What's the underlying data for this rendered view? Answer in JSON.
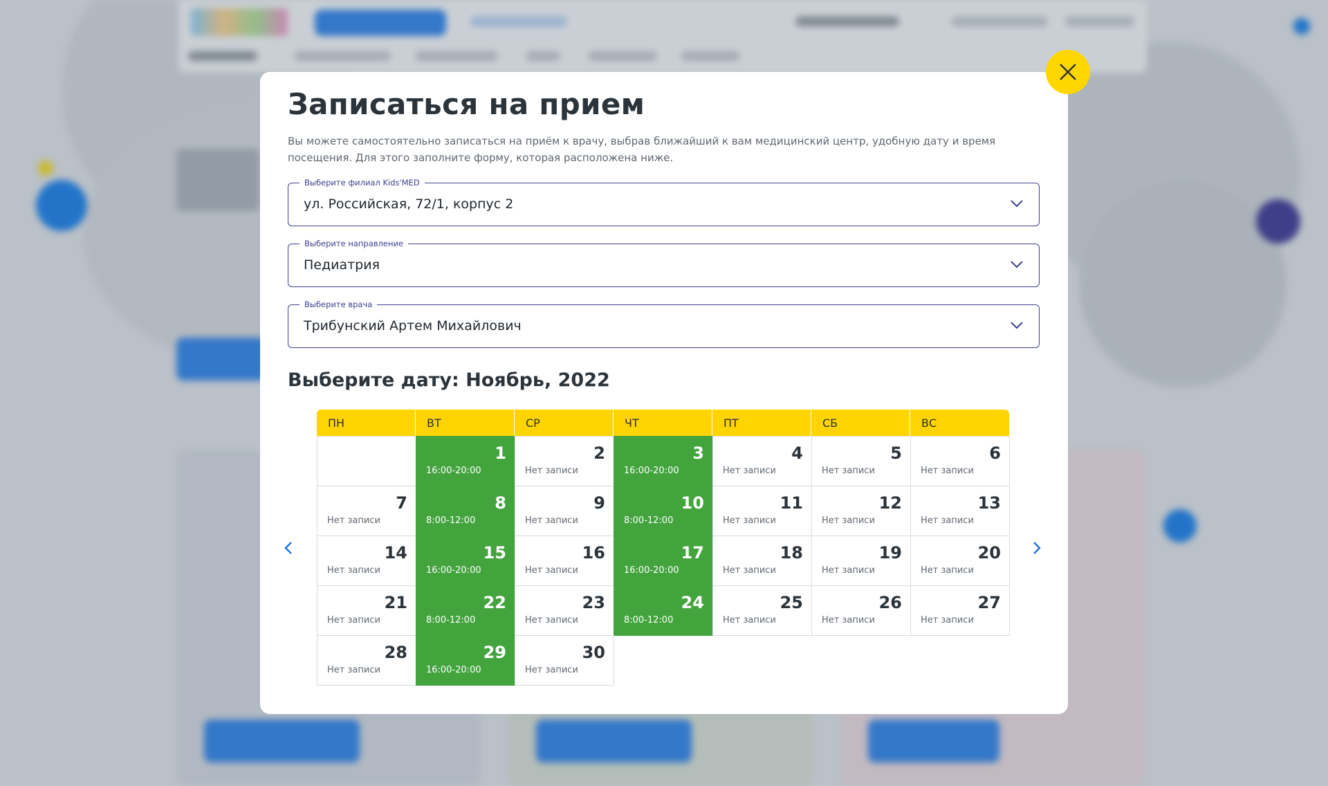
{
  "modal": {
    "title": "Записаться на прием",
    "description": "Вы можете самостоятельно записаться на приём к врачу, выбрав ближайший к вам медицинский центр, удобную дату и время посещения. Для этого заполните форму, которая расположена ниже."
  },
  "fields": {
    "branch": {
      "label": "Выберите филиал Kids'MED",
      "value": "ул. Российская, 72/1, корпус 2"
    },
    "direction": {
      "label": "Выберите направление",
      "value": "Педиатрия"
    },
    "doctor": {
      "label": "Выберите врача",
      "value": "Трибунский Артем Михайлович"
    }
  },
  "calendar": {
    "heading": "Выберите дату: Ноябрь, 2022",
    "weekdays": [
      "ПН",
      "ВТ",
      "СР",
      "ЧТ",
      "ПТ",
      "СБ",
      "ВС"
    ],
    "leading_empty_days": 1,
    "days": [
      {
        "day": "1",
        "info": "16:00-20:00",
        "available": true
      },
      {
        "day": "2",
        "info": "Нет записи",
        "available": false
      },
      {
        "day": "3",
        "info": "16:00-20:00",
        "available": true
      },
      {
        "day": "4",
        "info": "Нет записи",
        "available": false
      },
      {
        "day": "5",
        "info": "Нет записи",
        "available": false
      },
      {
        "day": "6",
        "info": "Нет записи",
        "available": false
      },
      {
        "day": "7",
        "info": "Нет записи",
        "available": false
      },
      {
        "day": "8",
        "info": "8:00-12:00",
        "available": true
      },
      {
        "day": "9",
        "info": "Нет записи",
        "available": false
      },
      {
        "day": "10",
        "info": "8:00-12:00",
        "available": true
      },
      {
        "day": "11",
        "info": "Нет записи",
        "available": false
      },
      {
        "day": "12",
        "info": "Нет записи",
        "available": false
      },
      {
        "day": "13",
        "info": "Нет записи",
        "available": false
      },
      {
        "day": "14",
        "info": "Нет записи",
        "available": false
      },
      {
        "day": "15",
        "info": "16:00-20:00",
        "available": true
      },
      {
        "day": "16",
        "info": "Нет записи",
        "available": false
      },
      {
        "day": "17",
        "info": "16:00-20:00",
        "available": true
      },
      {
        "day": "18",
        "info": "Нет записи",
        "available": false
      },
      {
        "day": "19",
        "info": "Нет записи",
        "available": false
      },
      {
        "day": "20",
        "info": "Нет записи",
        "available": false
      },
      {
        "day": "21",
        "info": "Нет записи",
        "available": false
      },
      {
        "day": "22",
        "info": "8:00-12:00",
        "available": true
      },
      {
        "day": "23",
        "info": "Нет записи",
        "available": false
      },
      {
        "day": "24",
        "info": "8:00-12:00",
        "available": true
      },
      {
        "day": "25",
        "info": "Нет записи",
        "available": false
      },
      {
        "day": "26",
        "info": "Нет записи",
        "available": false
      },
      {
        "day": "27",
        "info": "Нет записи",
        "available": false
      },
      {
        "day": "28",
        "info": "Нет записи",
        "available": false
      },
      {
        "day": "29",
        "info": "16:00-20:00",
        "available": true
      },
      {
        "day": "30",
        "info": "Нет записи",
        "available": false
      }
    ]
  },
  "icons": {
    "close": "close-icon",
    "dropdown": "chevron-down-icon",
    "prev": "chevron-left-icon",
    "next": "chevron-right-icon"
  },
  "colors": {
    "accent_yellow": "#ffd400",
    "available_green": "#43a43e",
    "field_border": "#3b3f8f",
    "arrow_blue": "#1a73d9"
  }
}
